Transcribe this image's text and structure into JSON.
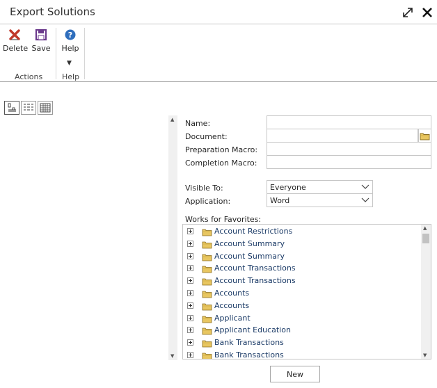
{
  "window": {
    "title": "Export Solutions",
    "expand_icon": "expand-icon",
    "close_icon": "close-icon"
  },
  "ribbon": {
    "buttons": [
      {
        "label": "Delete",
        "icon": "delete-icon"
      },
      {
        "label": "Save",
        "icon": "save-icon"
      },
      {
        "label": "Help",
        "icon": "help-icon"
      }
    ],
    "groups": [
      {
        "label": "Actions"
      },
      {
        "label": "Help"
      }
    ],
    "dropdown_glyph": "▼"
  },
  "view_buttons": [
    "form-view-icon",
    "list-view-icon",
    "grid-view-icon"
  ],
  "form": {
    "name_label": "Name:",
    "name_value": "",
    "document_label": "Document:",
    "document_value": "",
    "prep_macro_label": "Preparation Macro:",
    "prep_macro_value": "",
    "completion_macro_label": "Completion Macro:",
    "completion_macro_value": "",
    "visible_to_label": "Visible To:",
    "visible_to_value": "Everyone",
    "application_label": "Application:",
    "application_value": "Word",
    "favorites_label": "Works for Favorites:"
  },
  "tree": {
    "items": [
      {
        "label": "Account Restrictions"
      },
      {
        "label": "Account Summary"
      },
      {
        "label": "Account Summary"
      },
      {
        "label": "Account Transactions"
      },
      {
        "label": "Account Transactions"
      },
      {
        "label": "Accounts"
      },
      {
        "label": "Accounts"
      },
      {
        "label": "Applicant"
      },
      {
        "label": "Applicant Education"
      },
      {
        "label": "Bank Transactions"
      },
      {
        "label": "Bank Transactions"
      }
    ]
  },
  "new_button_label": "New",
  "colors": {
    "accent": "#1a3a66",
    "delete_red": "#c0392b",
    "save_purple": "#6b3a8c",
    "help_blue": "#2f6ebd",
    "folder_yellow": "#e8c660"
  }
}
